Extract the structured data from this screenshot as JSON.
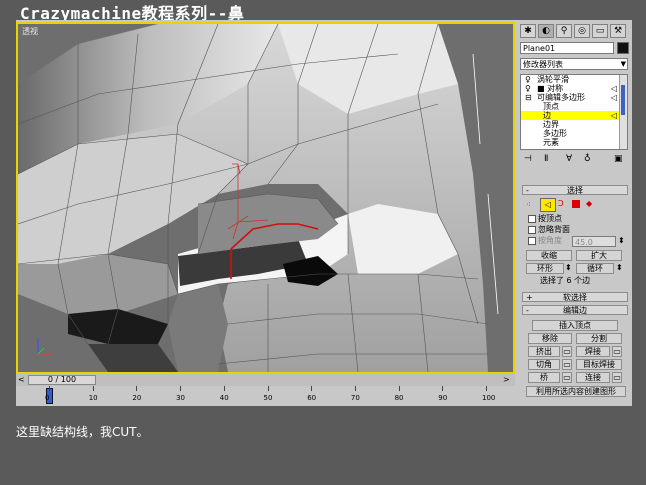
{
  "title": "Crazymachine教程系列--鼻",
  "caption": "这里缺结构线，我CUT。",
  "viewport": {
    "label": "透视"
  },
  "timeline": {
    "frame_display": "0 / 100",
    "ticks": [
      "0",
      "10",
      "20",
      "30",
      "40",
      "50",
      "60",
      "70",
      "80",
      "90",
      "100"
    ]
  },
  "command_panel": {
    "object_name": "Plane01",
    "modifier_list": "修改器列表",
    "stack": [
      {
        "label": "涡轮平滑",
        "icon": "lightbulb-icon"
      },
      {
        "label": "对称",
        "icon": "lightbulb-icon"
      },
      {
        "label": "可编辑多边形",
        "icon": "minus-icon"
      },
      {
        "label": "顶点"
      },
      {
        "label": "边",
        "selected": true
      },
      {
        "label": "边界"
      },
      {
        "label": "多边形"
      },
      {
        "label": "元素"
      }
    ],
    "selection": {
      "header": "选择",
      "by_vertex": "按顶点",
      "ignore_backfacing": "忽略背面",
      "by_angle": "按角度",
      "angle_value": "45.0",
      "shrink": "收缩",
      "grow": "扩大",
      "ring": "环形",
      "loop": "循环",
      "status": "选择了 6 个边"
    },
    "soft_selection": {
      "header": "软选择"
    },
    "edit_edges": {
      "header": "编辑边",
      "insert_vertex": "插入顶点",
      "remove": "移除",
      "split": "分割",
      "extrude": "挤出",
      "weld": "焊接",
      "chamfer": "切角",
      "target_weld": "目标焊接",
      "bridge": "桥",
      "connect": "连接",
      "create_shape": "利用所选内容创建图形"
    }
  },
  "colors": {
    "viewport_border": "#e6d400",
    "selected_edge": "#cc1111",
    "stack_selected": "#ffff00"
  }
}
